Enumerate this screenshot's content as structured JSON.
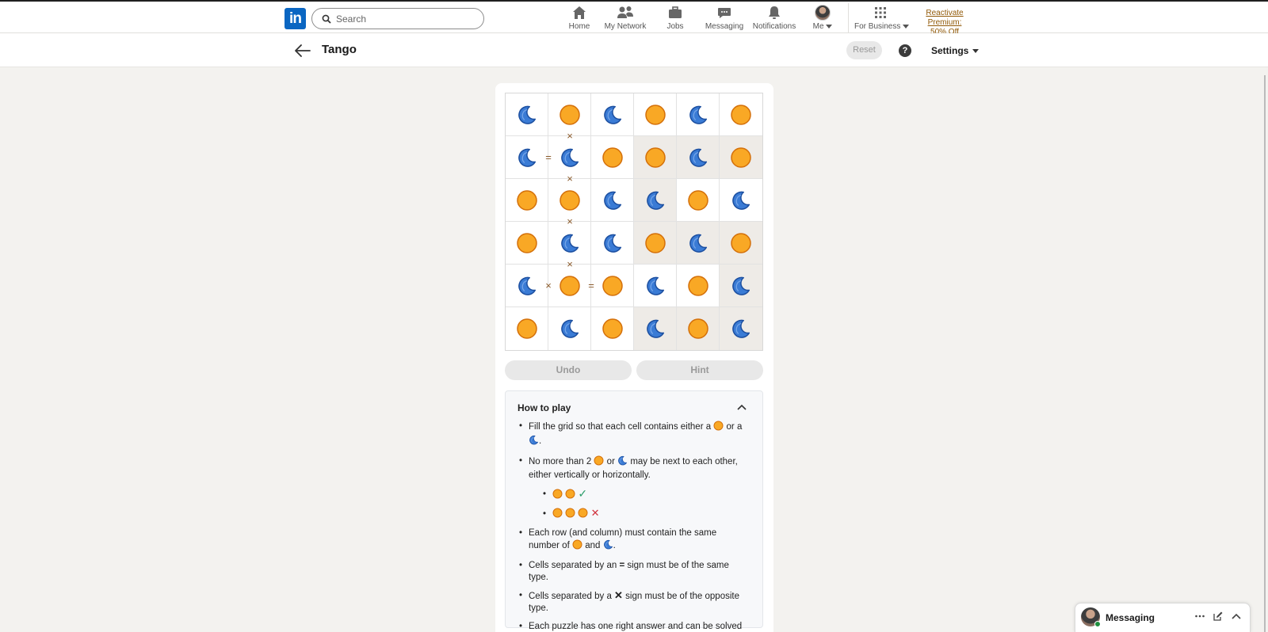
{
  "nav": {
    "search_placeholder": "Search",
    "items": [
      {
        "label": "Home",
        "icon": "home-icon"
      },
      {
        "label": "My Network",
        "icon": "people-icon"
      },
      {
        "label": "Jobs",
        "icon": "briefcase-icon"
      },
      {
        "label": "Messaging",
        "icon": "chat-icon"
      },
      {
        "label": "Notifications",
        "icon": "bell-icon"
      },
      {
        "label": "Me",
        "icon": "avatar"
      },
      {
        "label": "For Business",
        "icon": "grid-icon"
      }
    ],
    "premium_line1": "Reactivate Premium:",
    "premium_line2": "50% Off"
  },
  "header": {
    "title": "Tango",
    "reset_label": "Reset",
    "help_label": "?",
    "settings_label": "Settings"
  },
  "board": {
    "cells": [
      [
        "moon",
        "sun",
        "moon",
        "sun",
        "moon",
        "sun"
      ],
      [
        "moon",
        "moon",
        "sun",
        "sun",
        "moon",
        "sun"
      ],
      [
        "sun",
        "sun",
        "moon",
        "moon",
        "sun",
        "moon"
      ],
      [
        "sun",
        "moon",
        "moon",
        "sun",
        "moon",
        "sun"
      ],
      [
        "moon",
        "sun",
        "sun",
        "moon",
        "sun",
        "moon"
      ],
      [
        "sun",
        "moon",
        "sun",
        "moon",
        "sun",
        "moon"
      ]
    ],
    "shaded": [
      [
        false,
        false,
        false,
        false,
        false,
        false
      ],
      [
        false,
        false,
        false,
        true,
        true,
        true
      ],
      [
        false,
        false,
        false,
        true,
        false,
        false
      ],
      [
        false,
        false,
        false,
        true,
        true,
        true
      ],
      [
        false,
        false,
        false,
        false,
        false,
        true
      ],
      [
        false,
        false,
        false,
        true,
        true,
        true
      ]
    ],
    "signs": [
      {
        "type": "x",
        "between": [
          [
            0,
            1
          ],
          [
            1,
            1
          ]
        ]
      },
      {
        "type": "=",
        "between": [
          [
            1,
            0
          ],
          [
            1,
            1
          ]
        ]
      },
      {
        "type": "x",
        "between": [
          [
            1,
            1
          ],
          [
            2,
            1
          ]
        ]
      },
      {
        "type": "x",
        "between": [
          [
            2,
            1
          ],
          [
            3,
            1
          ]
        ]
      },
      {
        "type": "x",
        "between": [
          [
            3,
            1
          ],
          [
            4,
            1
          ]
        ]
      },
      {
        "type": "x",
        "between": [
          [
            4,
            0
          ],
          [
            4,
            1
          ]
        ]
      },
      {
        "type": "=",
        "between": [
          [
            4,
            1
          ],
          [
            4,
            2
          ]
        ]
      }
    ],
    "colors": {
      "sun": "#f9a825",
      "sun_border": "#d4700a",
      "moon": "#3a7bd5",
      "moon_border": "#1c4fa0",
      "sign": "#8a5a2b"
    }
  },
  "controls": {
    "undo_label": "Undo",
    "hint_label": "Hint"
  },
  "howto": {
    "title": "How to play",
    "rule1_a": "Fill the grid so that each cell contains either a",
    "rule1_b": "or a",
    "rule1_c": ".",
    "rule2_a": "No more than 2",
    "rule2_b": "or",
    "rule2_c": "may be next to each other, either vertically or horizontally.",
    "ok_mark": "✓",
    "bad_mark": "✕",
    "rule3_a": "Each row (and column) must contain the same number of",
    "rule3_b": "and",
    "rule3_c": ".",
    "rule4_a": "Cells separated by an",
    "rule4_sym": "=",
    "rule4_b": "sign must be of the same type.",
    "rule5_a": "Cells separated by a",
    "rule5_sym": "✕",
    "rule5_b": "sign must be of the opposite type.",
    "rule6": "Each puzzle has one right answer and can be solved via deduction (you should never have to make a guess)."
  },
  "messaging": {
    "label": "Messaging"
  }
}
